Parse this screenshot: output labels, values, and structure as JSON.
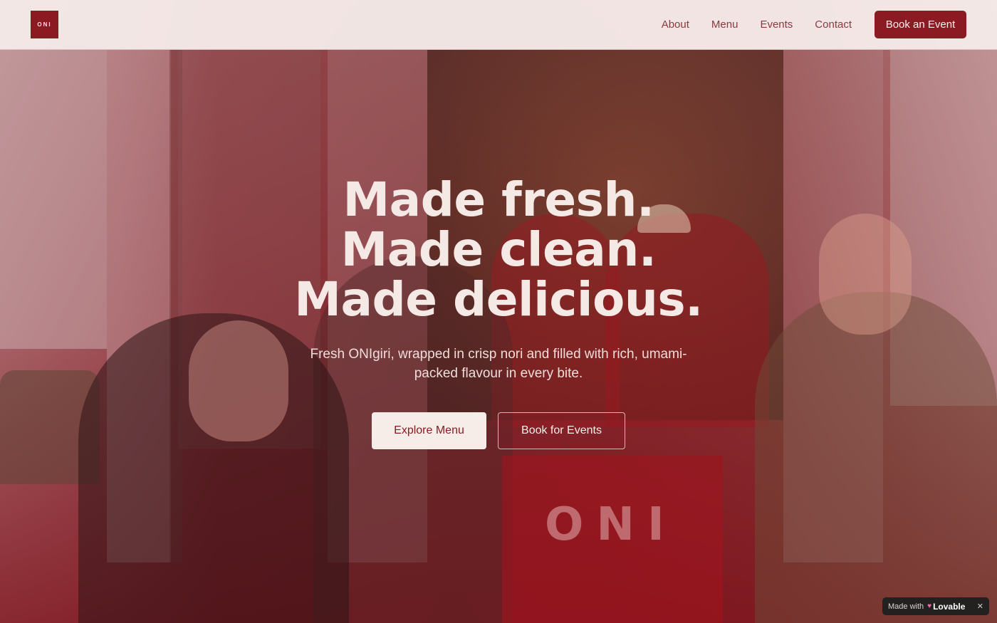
{
  "brand": {
    "logo_text": "ONI"
  },
  "nav": {
    "links": [
      "About",
      "Menu",
      "Events",
      "Contact"
    ],
    "cta_label": "Book an Event"
  },
  "hero": {
    "headline": [
      "Made fresh.",
      "Made clean.",
      "Made delicious."
    ],
    "subtitle": "Fresh ONIgiri, wrapped in crisp nori and filled with rich, umami-packed flavour in every bite.",
    "primary_cta": "Explore Menu",
    "secondary_cta": "Book for Events"
  },
  "badge": {
    "prefix": "Made with",
    "brand": "Lovable",
    "close": "✕"
  },
  "colors": {
    "brand_red": "#8b1a22",
    "cream": "#f6ece8",
    "nav_text": "#8a3a3f"
  }
}
